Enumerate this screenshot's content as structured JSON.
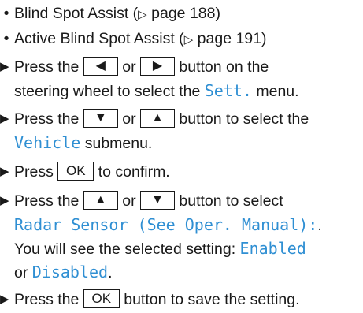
{
  "bullets": [
    {
      "label": "Blind Spot Assist",
      "ref_symbol": "▷",
      "ref_text": "page 188"
    },
    {
      "label": "Active Blind Spot Assist",
      "ref_symbol": "▷",
      "ref_text": "page 191"
    }
  ],
  "step_marker": "▶",
  "keys": {
    "left": "◀",
    "right": "▶",
    "down": "▼",
    "up": "▲",
    "ok": "OK"
  },
  "steps": [
    {
      "part1": "Press the",
      "or": "or",
      "part2": "button on the",
      "line2_text": "steering wheel to select the",
      "menu": "Sett.",
      "line2_end": "menu."
    },
    {
      "part1": "Press the",
      "or": "or",
      "part2": "button to select the",
      "submenu": "Vehicle",
      "line2_end": "submenu."
    },
    {
      "part1": "Press",
      "part2": "to confirm."
    },
    {
      "part1": "Press the",
      "or": "or",
      "part2": "button to select",
      "display_line": "Radar Sensor (See Oper. Manual):",
      "display_end": ".",
      "line3": "You will see the selected setting:",
      "enabled": "Enabled",
      "line4_or": "or",
      "disabled": "Disabled",
      "line4_end": "."
    },
    {
      "part1": "Press the",
      "part2": "button to save the setting."
    }
  ]
}
